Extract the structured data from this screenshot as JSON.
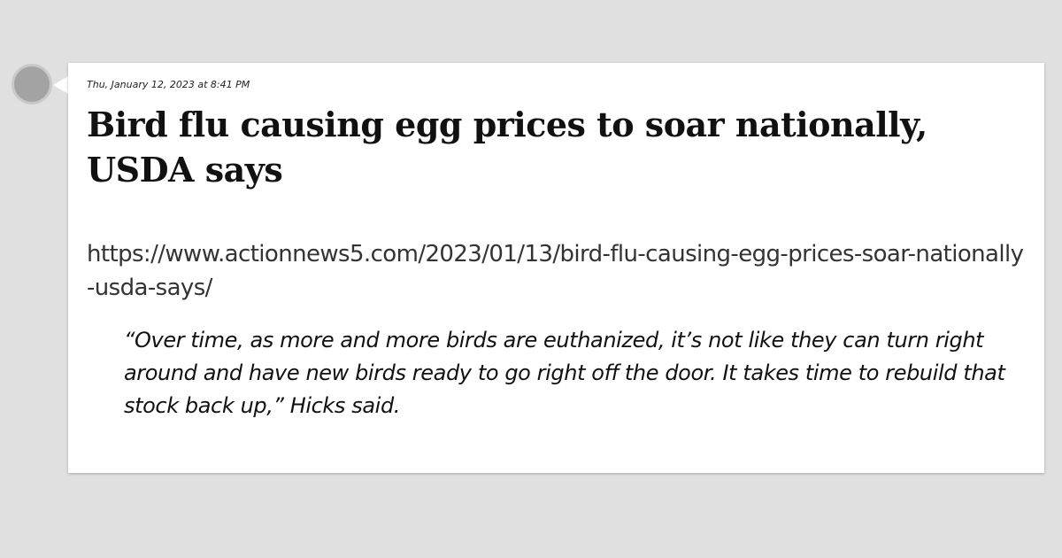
{
  "post": {
    "timestamp": "Thu, January 12, 2023 at 8:41 PM",
    "headline": "Bird flu causing egg prices to soar nationally, USDA says",
    "url": "https://www.actionnews5.com/2023/01/13/bird-flu-causing-egg-prices-soar-nationally-usda-says/",
    "quote": "“Over time, as more and more birds are euthanized, it’s not like they can turn right around and have new birds ready to go right off the door. It takes time to rebuild that stock back up,” Hicks said."
  },
  "colors": {
    "page_background": "#e0e0e0",
    "card_background": "#ffffff",
    "avatar": "#a3a3a3"
  }
}
